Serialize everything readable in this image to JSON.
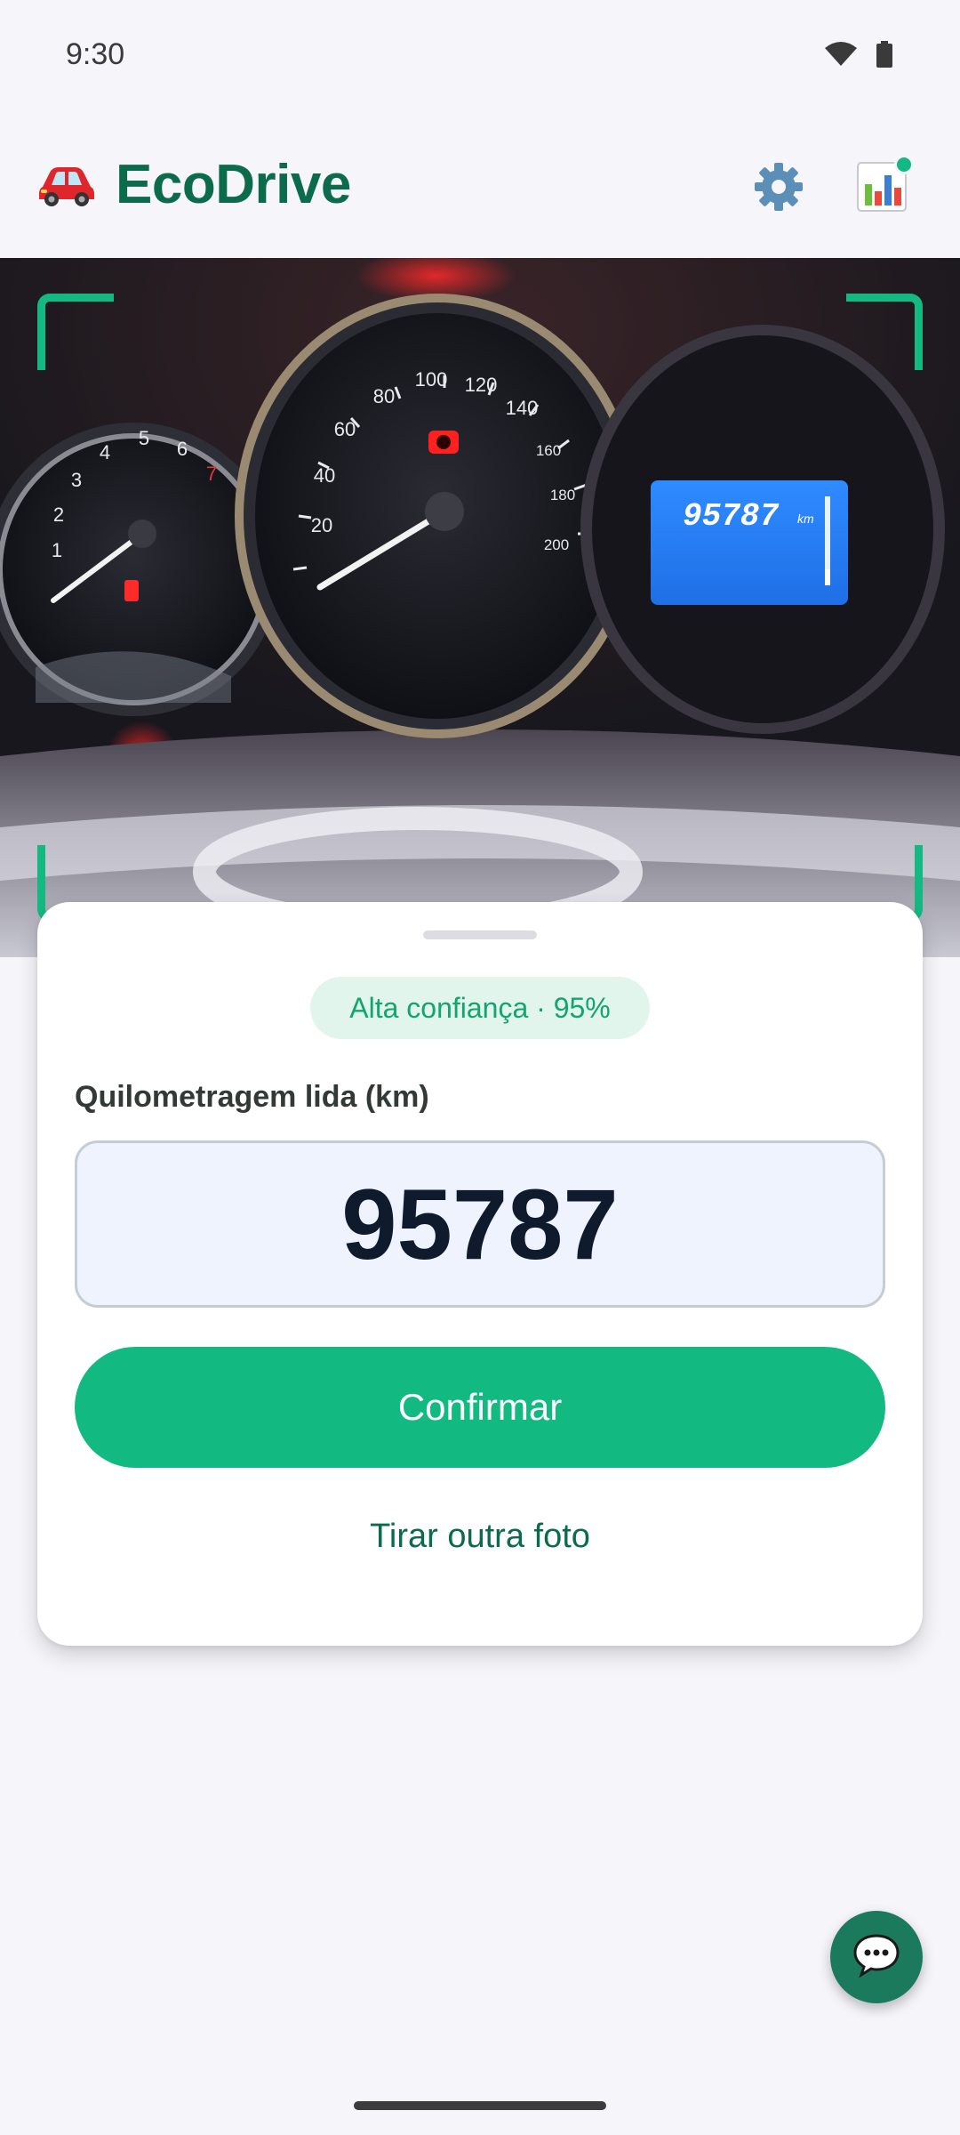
{
  "status_bar": {
    "time": "9:30",
    "icons": [
      "wifi-icon",
      "battery-icon"
    ]
  },
  "app_bar": {
    "brand_icon": "car-icon",
    "title": "EcoDrive",
    "actions": [
      {
        "icon": "gear-icon",
        "label": "settings"
      },
      {
        "icon": "bar-chart-icon",
        "label": "statistics",
        "has_notification": true
      }
    ]
  },
  "camera": {
    "odometer_display_text": "95787",
    "odometer_display_unit": "km",
    "speedometer_ticks": [
      "20",
      "40",
      "60",
      "80",
      "100",
      "120",
      "140",
      "160",
      "180",
      "200"
    ],
    "tachometer_ticks": [
      "1",
      "2",
      "3",
      "4",
      "5",
      "6",
      "7"
    ]
  },
  "sheet": {
    "confidence": "Alta confiança · 95%",
    "field_label": "Quilometragem lida (km)",
    "mileage_value": "95787",
    "confirm_label": "Confirmar",
    "retake_label": "Tirar outra foto"
  },
  "fab": {
    "icon": "chat-bubble-icon"
  },
  "colors": {
    "brand_green": "#0b6b4a",
    "accent_green": "#12b981",
    "fab_green": "#1c7a5c",
    "badge_bg": "#e2f5ec",
    "input_bg": "#eef3fd",
    "background": "#f5f5fa"
  }
}
